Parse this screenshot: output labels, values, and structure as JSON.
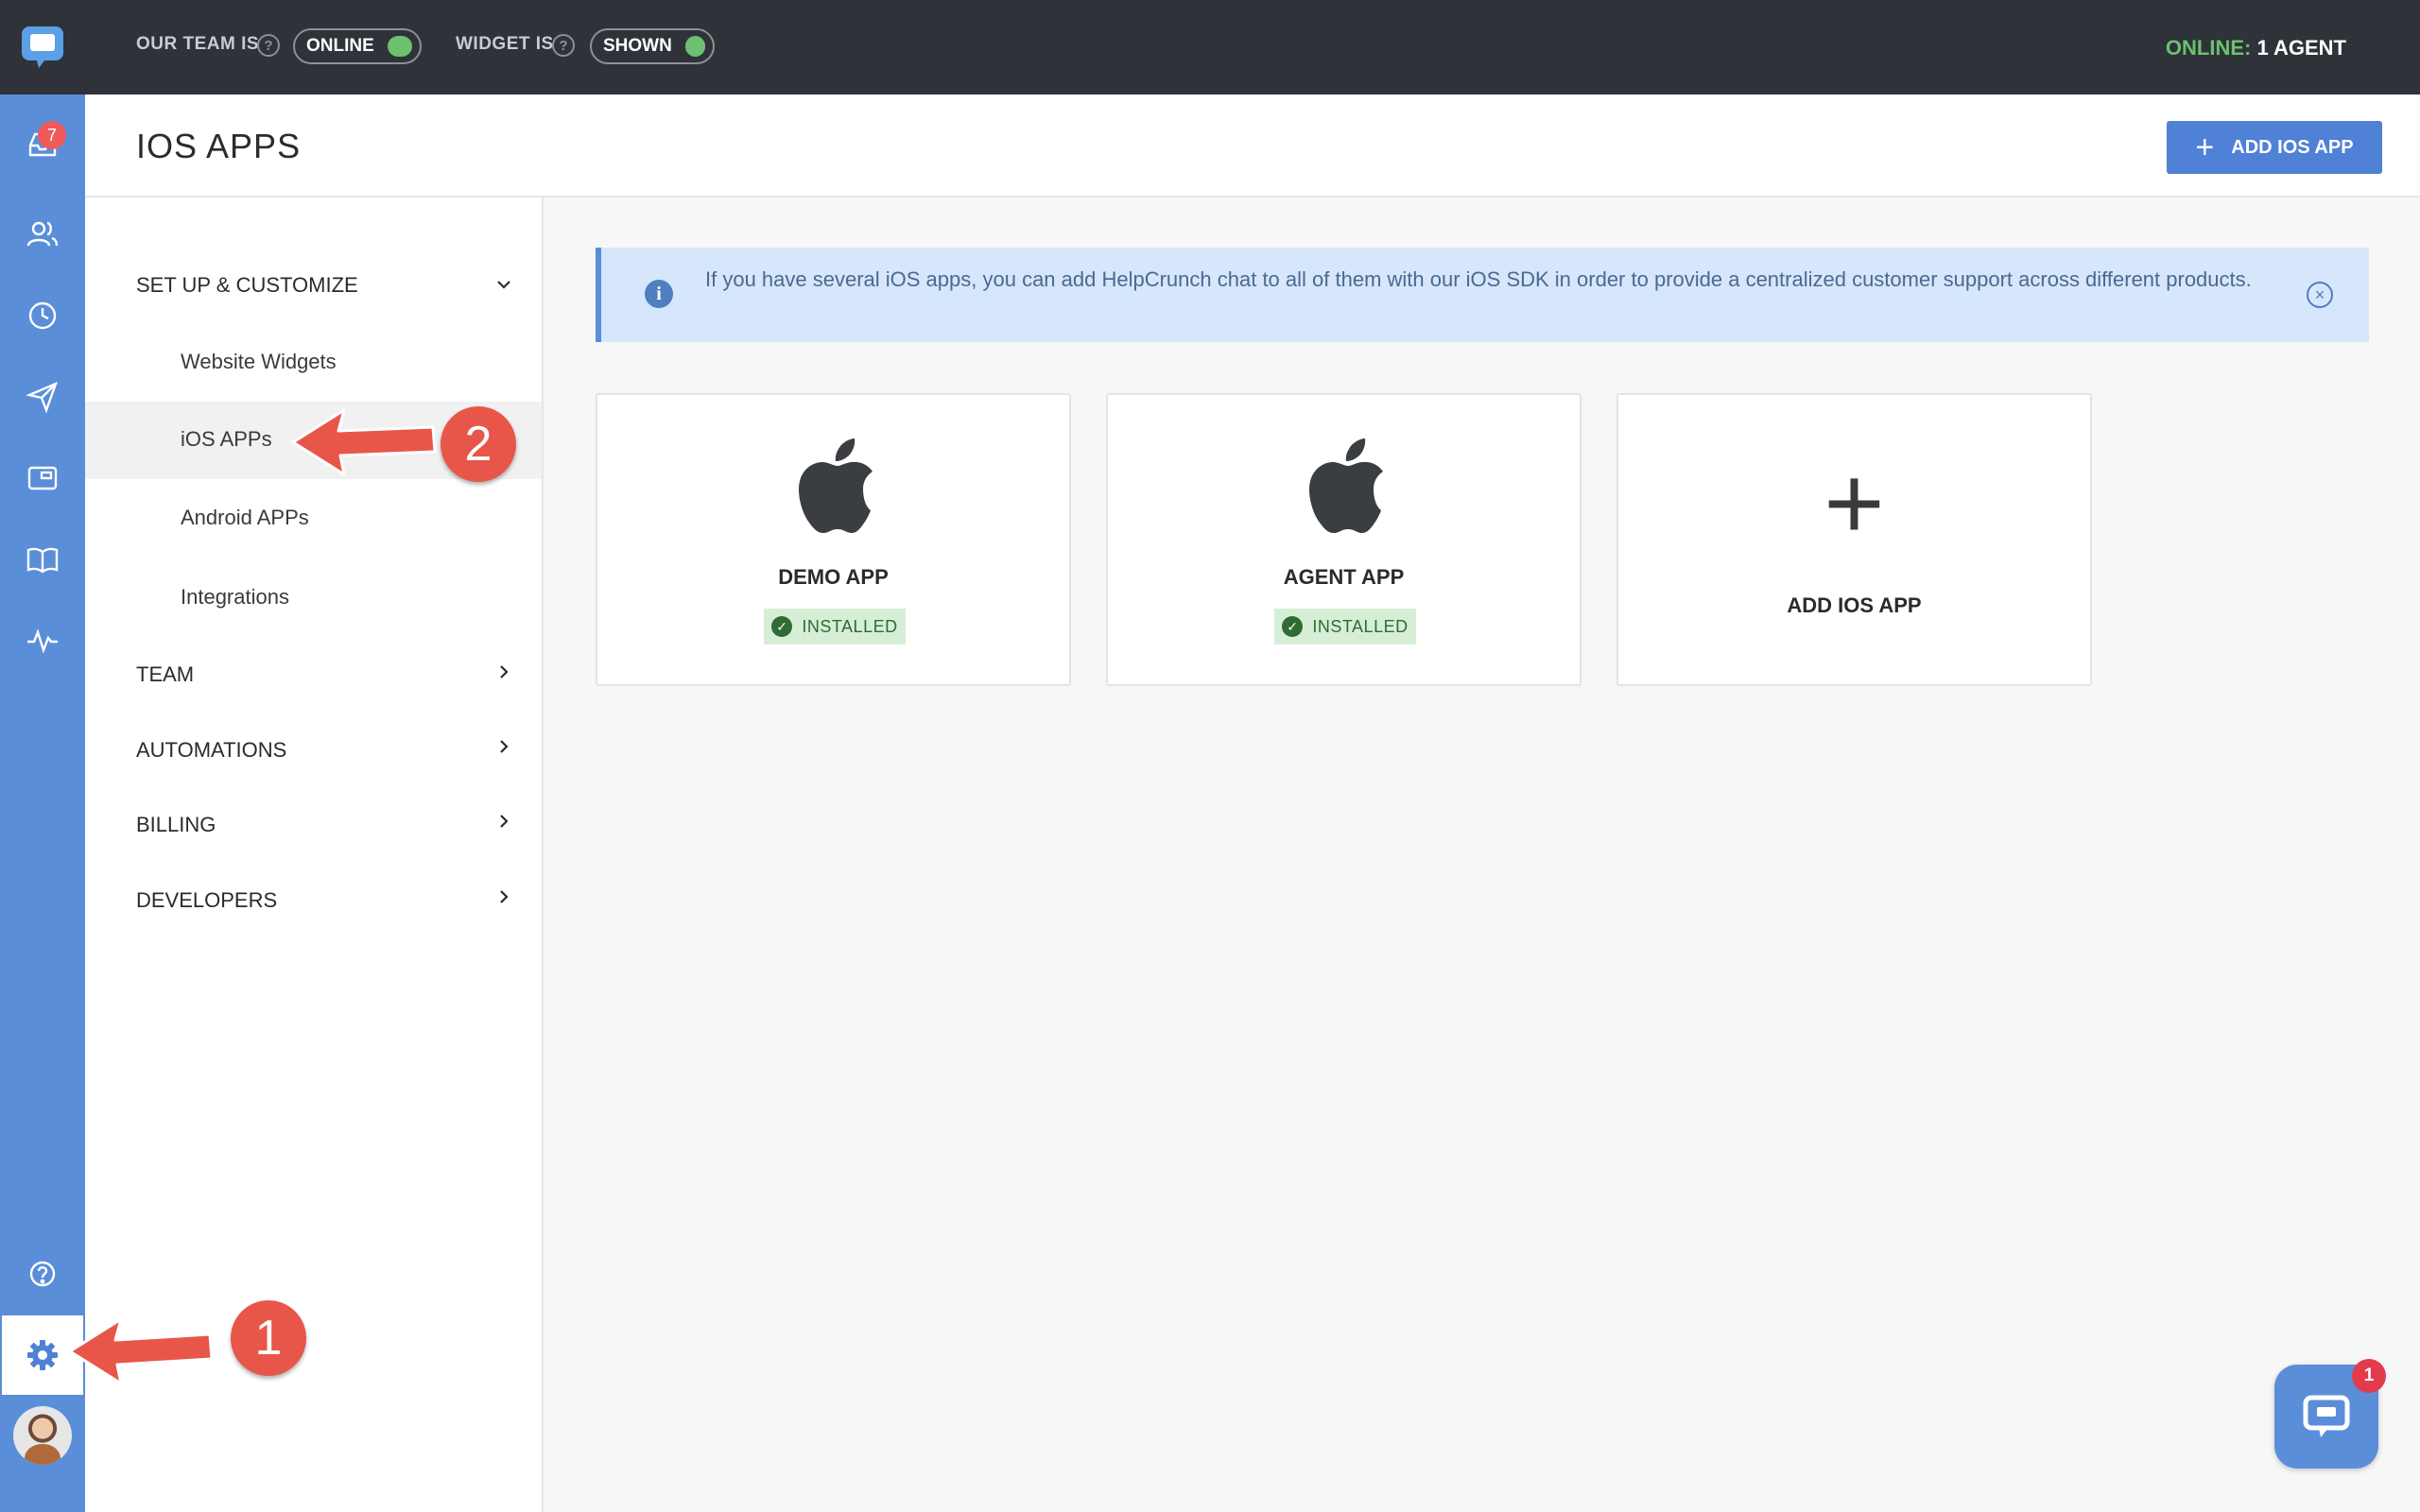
{
  "topbar": {
    "team_label": "OUR TEAM IS",
    "team_state": "ONLINE",
    "widget_label": "WIDGET IS",
    "widget_state": "SHOWN",
    "online_key": "ONLINE:",
    "online_value": "1 AGENT",
    "help_glyph": "?"
  },
  "rail": {
    "inbox_badge": "7",
    "icons": [
      "chat-logo-icon",
      "inbox-icon",
      "contacts-icon",
      "history-icon",
      "send-icon",
      "widget-icon",
      "knowledge-base-icon",
      "analytics-icon",
      "help-icon",
      "gear-icon",
      "avatar"
    ]
  },
  "header": {
    "title": "IOS APPS",
    "add_button_icon": "+",
    "add_button": "ADD IOS APP"
  },
  "menu": {
    "setup": "SET UP & CUSTOMIZE",
    "items": [
      "Website Widgets",
      "iOS APPs",
      "Android APPs",
      "Integrations"
    ],
    "team": "TEAM",
    "automations": "AUTOMATIONS",
    "billing": "BILLING",
    "developers": "DEVELOPERS"
  },
  "notice": {
    "info_glyph": "i",
    "text": "If you have several iOS apps, you can add HelpCrunch chat to all of them with our iOS SDK in order to provide a centralized customer support across different products.",
    "close_glyph": "×"
  },
  "cards": [
    {
      "name": "DEMO APP",
      "status": "INSTALLED"
    },
    {
      "name": "AGENT APP",
      "status": "INSTALLED"
    }
  ],
  "add_card": {
    "plus": "+",
    "label": "ADD IOS APP"
  },
  "check_glyph": "✓",
  "annotations": {
    "step1": "1",
    "step2": "2"
  },
  "chat_widget": {
    "badge": "1"
  },
  "colors": {
    "accent": "#4f81d6",
    "rail": "#5a8ed9",
    "topbar": "#2f3238",
    "online": "#6cc070",
    "installed_bg": "#d7eed6",
    "annotation": "#e8564a"
  }
}
